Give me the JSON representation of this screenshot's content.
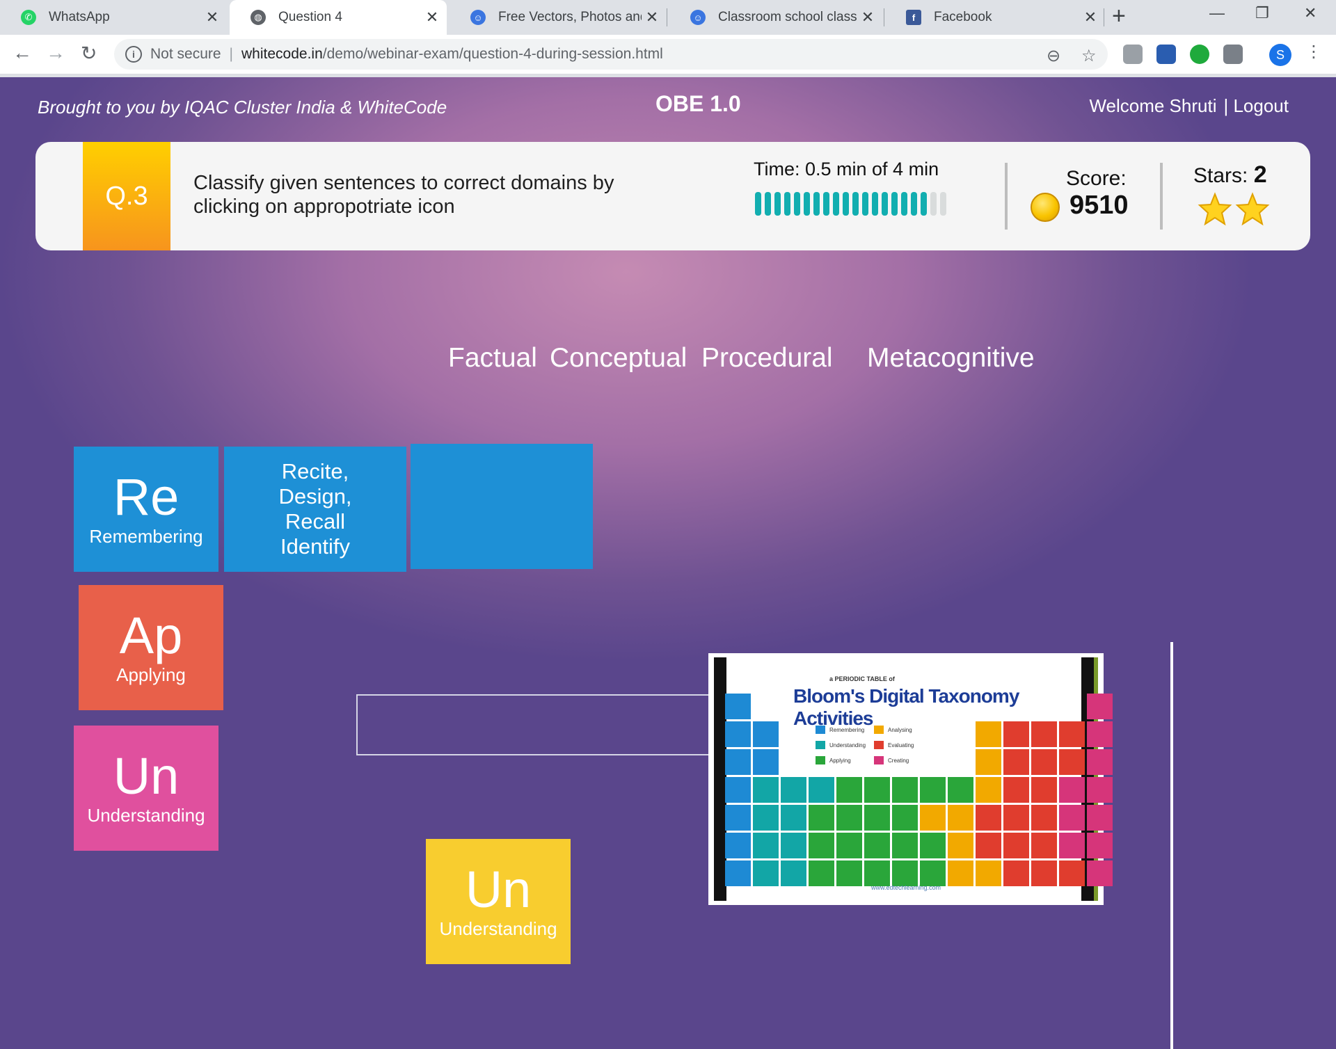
{
  "browser": {
    "tabs": [
      {
        "title": "WhatsApp",
        "favicon": "whatsapp-icon",
        "active": false
      },
      {
        "title": "Question 4",
        "favicon": "globe-icon",
        "active": true
      },
      {
        "title": "Free Vectors, Photos and PS",
        "favicon": "robot-icon",
        "active": false
      },
      {
        "title": "Classroom school class roo",
        "favicon": "robot-icon",
        "active": false
      },
      {
        "title": "Facebook",
        "favicon": "facebook-icon",
        "active": false
      }
    ],
    "security_label": "Not secure",
    "url_domain": "whitecode.in",
    "url_path": "/demo/webinar-exam/question-4-during-session.html",
    "profile_initial": "S"
  },
  "header": {
    "brought_by": "Brought to you by IQAC Cluster India  & WhiteCode",
    "app_title": "OBE 1.0",
    "welcome": "Welcome Shruti",
    "logout": "| Logout"
  },
  "question": {
    "number": "Q.3",
    "text": "Classify given sentences to correct domains by clicking on appropotriate icon",
    "time_label": "Time:  0.5 min of 4 min",
    "time_used_min": 0.5,
    "time_total_min": 4,
    "timer_progress": 0.875,
    "score_label": "Score:",
    "score_value": "9510",
    "stars_label": "Stars:",
    "stars_value": "2"
  },
  "domains": [
    "Factual",
    "Conceptual",
    "Procedural",
    "Metacognitive"
  ],
  "tiles": [
    {
      "big": "Re",
      "small": "Remembering",
      "color": "#1e90d6"
    },
    {
      "big": "Ap",
      "small": "Applying",
      "color": "#e8604a"
    },
    {
      "big": "Un",
      "small": "Understanding",
      "color": "#e0509e"
    },
    {
      "big": "Un",
      "small": "Understanding",
      "color": "#f8cd2f"
    }
  ],
  "verbs_card": [
    "Recite,",
    "Design,",
    "Recall",
    "Identify"
  ],
  "blooms_image": {
    "subtitle": "a PERIODIC TABLE of",
    "title": "Bloom's Digital Taxonomy Activities",
    "footer": "www.edtechlearning.com",
    "legend": [
      "Remembering",
      "Understanding",
      "Applying",
      "Analysing",
      "Evaluating",
      "Creating"
    ]
  },
  "colors": {
    "accent_teal": "#12aeb0",
    "badge_orange": "#f7941d",
    "tile_blue": "#1e90d6"
  }
}
